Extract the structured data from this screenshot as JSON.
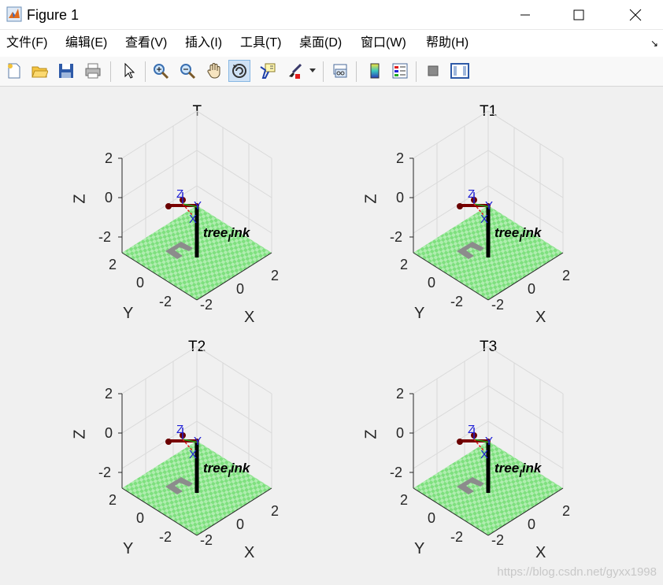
{
  "window": {
    "title": "Figure 1",
    "minimize_icon": "minimize-icon",
    "maximize_icon": "maximize-icon",
    "close_icon": "close-icon"
  },
  "menu": {
    "items": [
      {
        "label": "文件",
        "key": "(F)"
      },
      {
        "label": "编辑",
        "key": "(E)"
      },
      {
        "label": "查看",
        "key": "(V)"
      },
      {
        "label": "插入",
        "key": "(I)"
      },
      {
        "label": "工具",
        "key": "(T)"
      },
      {
        "label": "桌面",
        "key": "(D)"
      },
      {
        "label": "窗口",
        "key": "(W)"
      },
      {
        "label": "帮助",
        "key": "(H)"
      }
    ],
    "corner_glyph": "↘"
  },
  "toolbar": {
    "buttons": [
      "new-figure-icon",
      "open-file-icon",
      "save-icon",
      "print-icon",
      "pointer-icon",
      "zoom-in-icon",
      "zoom-out-icon",
      "pan-hand-icon",
      "rotate-3d-icon",
      "data-cursor-icon",
      "brush-icon",
      "link-plot-icon",
      "colorbar-icon",
      "legend-icon",
      "hide-plot-tools-icon",
      "show-plot-tools-icon"
    ],
    "active": "rotate-3d-icon"
  },
  "plots": [
    {
      "title": "T",
      "robot_label": "tree",
      "robot_label_sub": "l",
      "robot_label_end": "ink"
    },
    {
      "title": "T1",
      "robot_label": "tree",
      "robot_label_sub": "l",
      "robot_label_end": "ink"
    },
    {
      "title": "T2",
      "robot_label": "tree",
      "robot_label_sub": "l",
      "robot_label_end": "ink"
    },
    {
      "title": "T3",
      "robot_label": "tree",
      "robot_label_sub": "l",
      "robot_label_end": "ink"
    }
  ],
  "axes": {
    "z_ticks": [
      "2",
      "0",
      "-2"
    ],
    "y_ticks": [
      "2",
      "0",
      "-2"
    ],
    "x_ticks": [
      "-2",
      "0",
      "2"
    ],
    "xlabel": "X",
    "ylabel": "Y",
    "zlabel": "Z",
    "frame_axis_labels": {
      "x": "X",
      "y": "Y",
      "z": "Z"
    }
  },
  "colors": {
    "floor": "#7ee07e",
    "robot_link": "#000000",
    "frame_blue": "#1f1fd6",
    "frame_red": "#e01b1b",
    "frame_green": "#1faa1f"
  },
  "watermark": "https://blog.csdn.net/gyxx1998"
}
